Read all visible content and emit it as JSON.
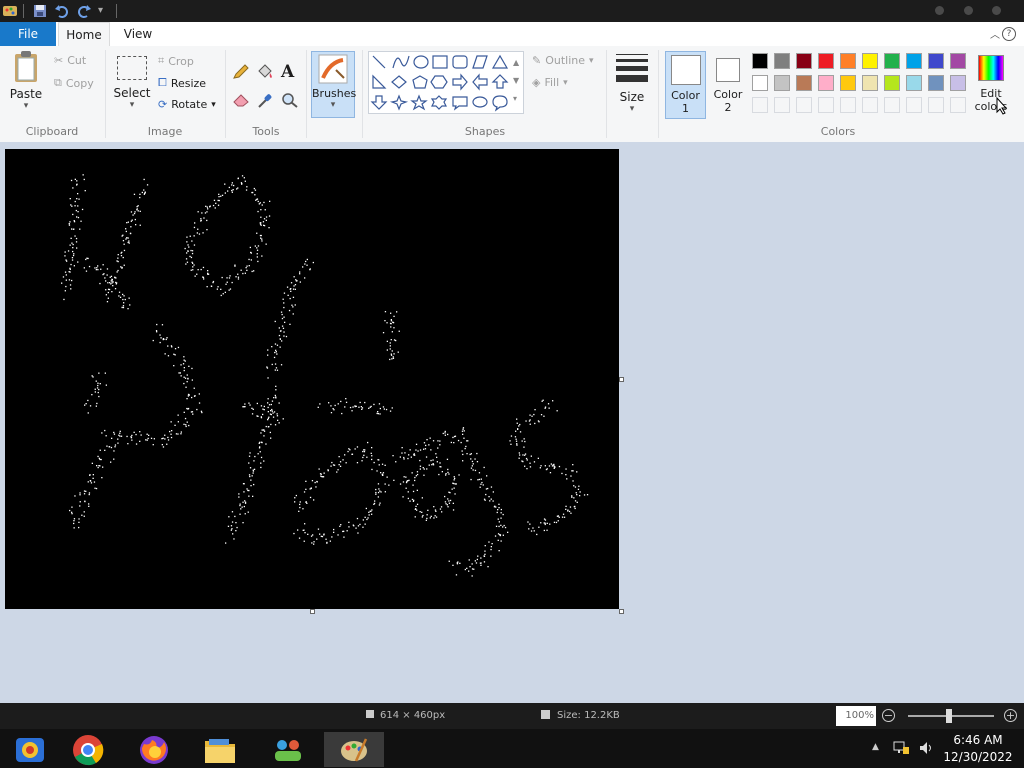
{
  "tabs": {
    "file": "File",
    "home": "Home",
    "view": "View"
  },
  "clipboard": {
    "paste": "Paste",
    "cut": "Cut",
    "copy": "Copy",
    "label": "Clipboard"
  },
  "image": {
    "select": "Select",
    "crop": "Crop",
    "resize": "Resize",
    "rotate": "Rotate",
    "label": "Image"
  },
  "tools": {
    "label": "Tools",
    "text_glyph": "A"
  },
  "brushes": {
    "label": "Brushes"
  },
  "shapes": {
    "outline": "Outline",
    "fill": "Fill",
    "label": "Shapes"
  },
  "size": {
    "label": "Size"
  },
  "color1": {
    "line1": "Color",
    "line2": "1"
  },
  "color2": {
    "line1": "Color",
    "line2": "2"
  },
  "edit_colors": {
    "line1": "Edit",
    "line2": "colors"
  },
  "colors": {
    "label": "Colors",
    "row1": [
      "#000000",
      "#7f7f7f",
      "#880015",
      "#ed1c24",
      "#ff7f27",
      "#fff200",
      "#22b14c",
      "#00a2e8",
      "#3f48cc",
      "#a349a4"
    ],
    "row2": [
      "#ffffff",
      "#c3c3c3",
      "#b97a57",
      "#ffaec9",
      "#ffc90e",
      "#efe4b0",
      "#b5e61d",
      "#99d9ea",
      "#7092be",
      "#c8bfe7"
    ]
  },
  "status": {
    "dimensions": "614 × 460px",
    "size": "Size: 12.2KB",
    "zoom": "100%"
  },
  "clock": {
    "time": "6:46 AM",
    "date": "12/30/2022"
  }
}
